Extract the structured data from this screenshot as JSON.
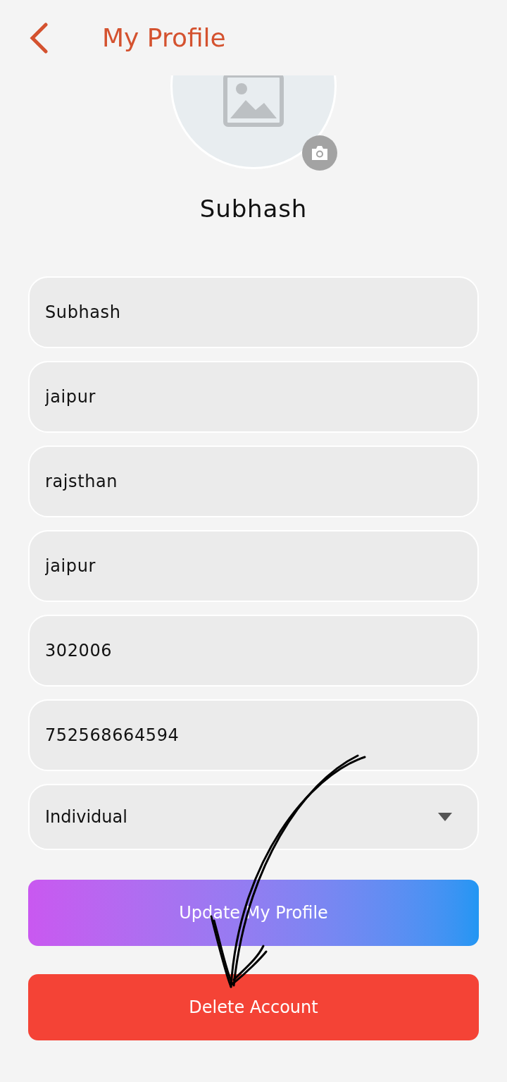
{
  "header": {
    "title": "My Profile"
  },
  "profile": {
    "name": "Subhash"
  },
  "fields": [
    {
      "kind": "text",
      "value": "Subhash"
    },
    {
      "kind": "text",
      "value": "jaipur"
    },
    {
      "kind": "text",
      "value": "rajsthan"
    },
    {
      "kind": "text",
      "value": "jaipur"
    },
    {
      "kind": "text",
      "value": "302006"
    },
    {
      "kind": "text",
      "value": "752568664594"
    },
    {
      "kind": "select",
      "value": "Individual"
    }
  ],
  "buttons": [
    {
      "kind": "primary",
      "label": "Update My Profile"
    },
    {
      "kind": "danger",
      "label": "Delete Account"
    }
  ]
}
